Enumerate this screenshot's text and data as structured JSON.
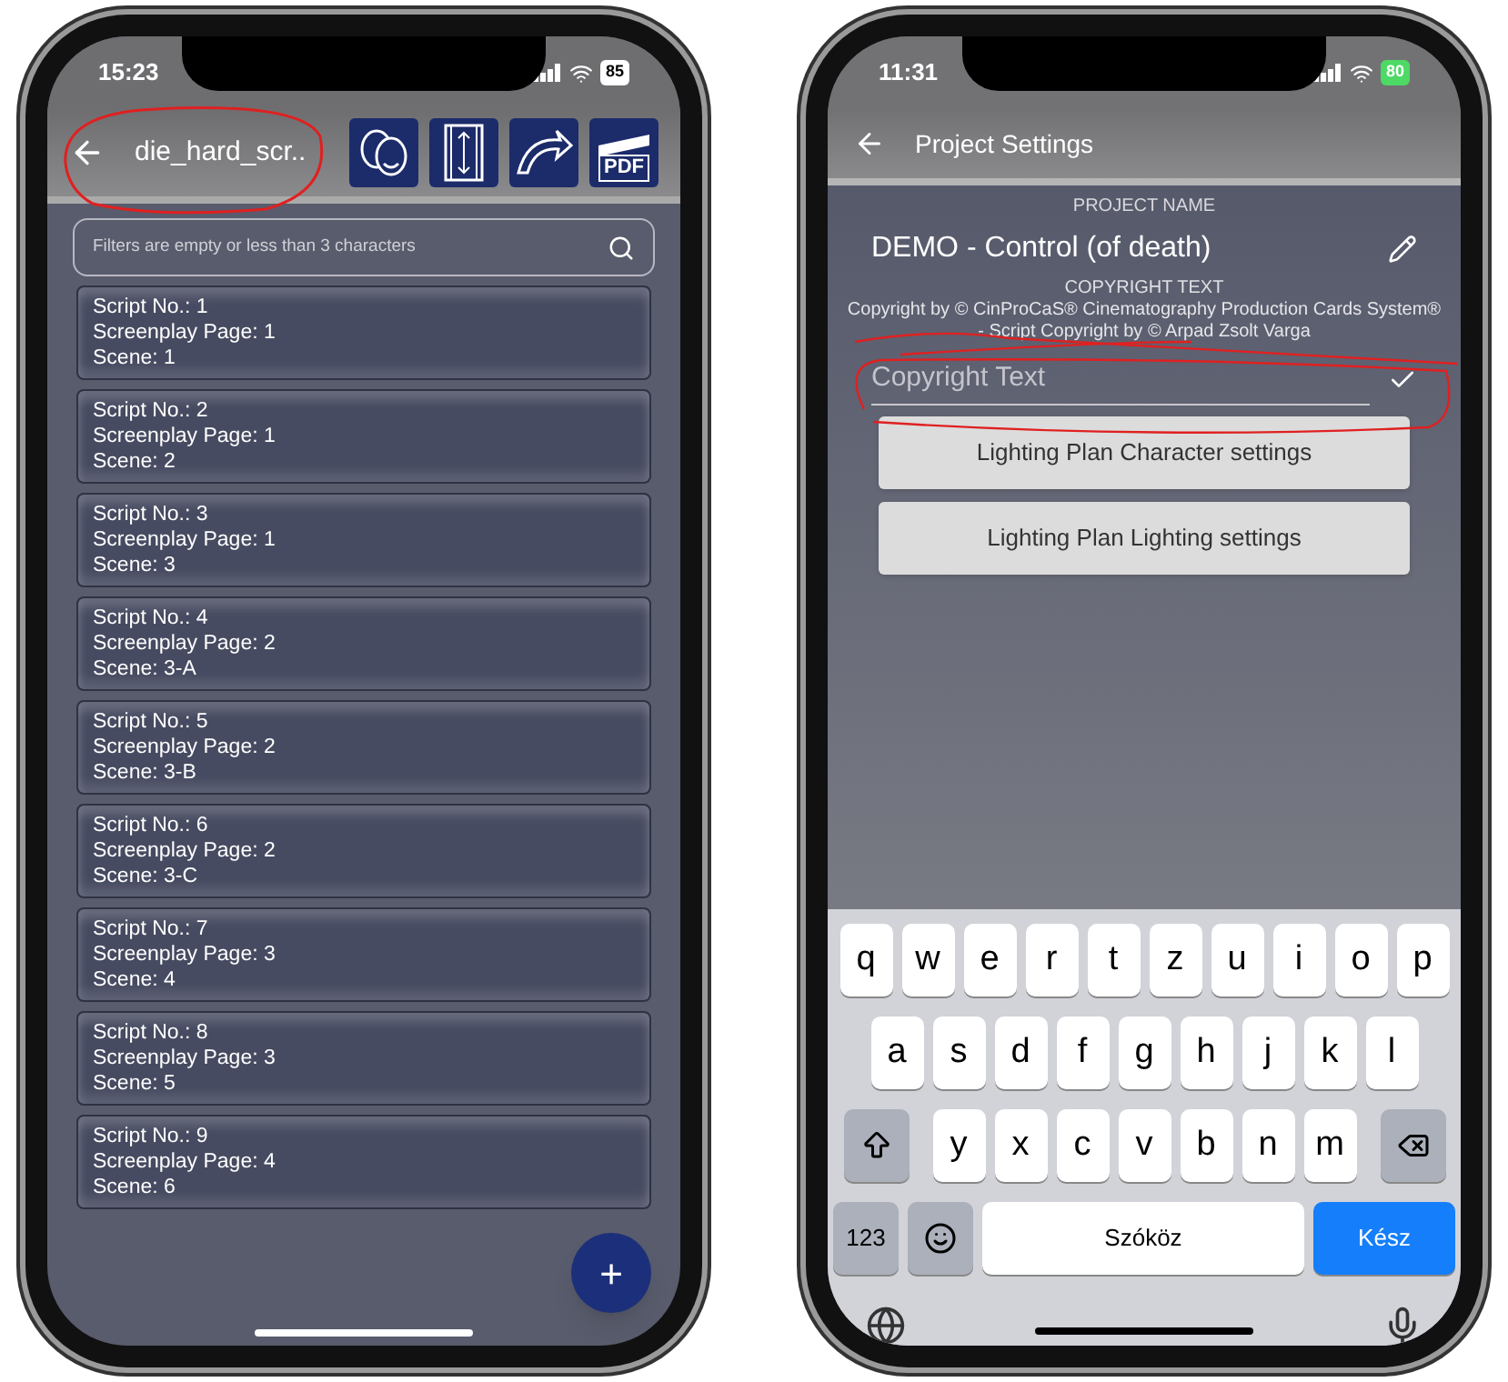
{
  "left_screen": {
    "status_bar": {
      "time": "15:23",
      "battery": "85"
    },
    "title": "die_hard_scr..",
    "pdf_label": "PDF",
    "search": {
      "placeholder": "Filters are empty or less than 3 characters"
    },
    "scripts": [
      {
        "script_no": "Script No.: 1",
        "page": "Screenplay Page: 1",
        "scene": "Scene: 1"
      },
      {
        "script_no": "Script No.: 2",
        "page": "Screenplay Page: 1",
        "scene": "Scene: 2"
      },
      {
        "script_no": "Script No.: 3",
        "page": "Screenplay Page: 1",
        "scene": "Scene: 3"
      },
      {
        "script_no": "Script No.: 4",
        "page": "Screenplay Page: 2",
        "scene": "Scene: 3-A"
      },
      {
        "script_no": "Script No.: 5",
        "page": "Screenplay Page: 2",
        "scene": "Scene: 3-B"
      },
      {
        "script_no": "Script No.: 6",
        "page": "Screenplay Page: 2",
        "scene": "Scene: 3-C"
      },
      {
        "script_no": "Script No.: 7",
        "page": "Screenplay Page: 3",
        "scene": "Scene: 4"
      },
      {
        "script_no": "Script No.: 8",
        "page": "Screenplay Page: 3",
        "scene": "Scene: 5"
      },
      {
        "script_no": "Script No.: 9",
        "page": "Screenplay Page: 4",
        "scene": "Scene: 6"
      }
    ],
    "fab": "+"
  },
  "right_screen": {
    "status_bar": {
      "time": "11:31",
      "battery": "80"
    },
    "title": "Project Settings",
    "project_name_label": "PROJECT NAME",
    "project_name": "DEMO - Control (of death)",
    "copyright_label": "COPYRIGHT TEXT",
    "copyright": "Copyright by © CinProCaS® Cinematography Production Cards System® - Script Copyright by © Arpad Zsolt Varga",
    "copyright_field": {
      "placeholder": "Copyright Text"
    },
    "buttons": [
      "Lighting Plan Character settings",
      "Lighting Plan Lighting settings"
    ],
    "keyboard": {
      "top_row": [
        {
          "kind": "letter",
          "label": "q"
        },
        {
          "kind": "letter",
          "label": "w"
        },
        {
          "kind": "letter",
          "label": "e"
        },
        {
          "kind": "letter",
          "label": "r"
        },
        {
          "kind": "letter",
          "label": "t"
        },
        {
          "kind": "letter",
          "label": "z"
        },
        {
          "kind": "letter",
          "label": "u"
        },
        {
          "kind": "letter",
          "label": "i"
        },
        {
          "kind": "letter",
          "label": "o"
        },
        {
          "kind": "letter",
          "label": "p"
        }
      ],
      "middle_row": [
        {
          "kind": "letter",
          "label": "a"
        },
        {
          "kind": "letter",
          "label": "s"
        },
        {
          "kind": "letter",
          "label": "d"
        },
        {
          "kind": "letter",
          "label": "f"
        },
        {
          "kind": "letter",
          "label": "g"
        },
        {
          "kind": "letter",
          "label": "h"
        },
        {
          "kind": "letter",
          "label": "j"
        },
        {
          "kind": "letter",
          "label": "k"
        },
        {
          "kind": "letter",
          "label": "l"
        }
      ],
      "bottom_row": [
        {
          "kind": "shift"
        },
        {
          "kind": "letter",
          "label": "y"
        },
        {
          "kind": "letter",
          "label": "x"
        },
        {
          "kind": "letter",
          "label": "c"
        },
        {
          "kind": "letter",
          "label": "v"
        },
        {
          "kind": "letter",
          "label": "b"
        },
        {
          "kind": "letter",
          "label": "n"
        },
        {
          "kind": "letter",
          "label": "m"
        },
        {
          "kind": "backspace"
        }
      ],
      "function_row": [
        {
          "kind": "mode",
          "label": "123"
        },
        {
          "kind": "emoji"
        },
        {
          "kind": "space",
          "label": "Szóköz"
        },
        {
          "kind": "done",
          "label": "Kész"
        }
      ]
    }
  }
}
